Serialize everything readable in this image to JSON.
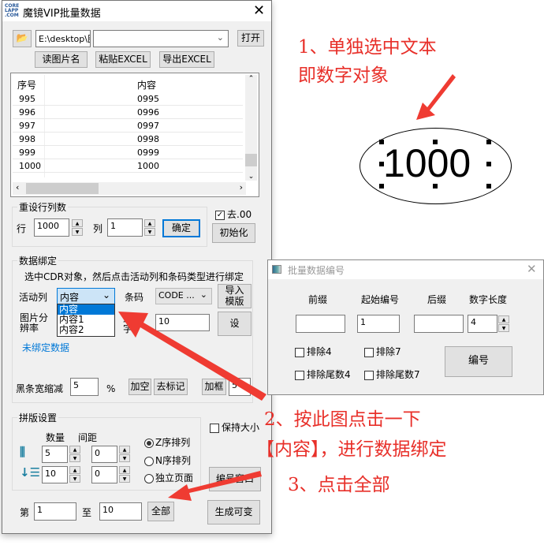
{
  "main": {
    "title": "魔镜VIP批量数据",
    "logo": "CORE LAPP .COM",
    "path": "E:\\desktop\\图",
    "combo": "",
    "open": "打开",
    "read_names": "读图片名",
    "paste_excel": "粘贴EXCEL",
    "export_excel": "导出EXCEL",
    "table": {
      "headers": [
        "序号",
        "内容"
      ],
      "rows": [
        [
          "995",
          "0995"
        ],
        [
          "996",
          "0996"
        ],
        [
          "997",
          "0997"
        ],
        [
          "998",
          "0998"
        ],
        [
          "999",
          "0999"
        ],
        [
          "1000",
          "1000"
        ]
      ]
    },
    "reset": {
      "legend": "重设行列数",
      "row_label": "行",
      "row_value": "1000",
      "col_label": "列",
      "col_value": "1",
      "confirm": "确定",
      "remove00": "去.00",
      "remove00_checked": true,
      "init": "初始化"
    },
    "bind": {
      "legend": "数据绑定",
      "hint": "选中CDR对象，然后点击活动列和条码类型进行绑定",
      "active_label": "活动列",
      "active_value": "内容",
      "options": [
        "内容",
        "内容1",
        "内容2"
      ],
      "barcode_label": "条码",
      "barcode_value": "CODE ...",
      "import_template": "导入模版",
      "img_res": "图片分辨率",
      "max_label": "最大字",
      "max_value": "10",
      "set": "设",
      "unbound": "未绑定数据",
      "bar_reduce_label": "黑条宽缩减",
      "bar_reduce_value": "5",
      "percent": "%",
      "add_blank": "加空",
      "remove_mark": "去标记",
      "add_frame": "加框",
      "frame_value": "5"
    },
    "layout": {
      "legend": "拼版设置",
      "qty": "数量",
      "gap": "间距",
      "h_qty": "5",
      "h_gap": "0",
      "v_qty": "10",
      "v_gap": "0",
      "z_order": "Z序排列",
      "n_order": "N序排列",
      "single": "独立页面",
      "keep_size": "保持大小",
      "number_window": "编号窗口"
    },
    "footer": {
      "from_label": "第",
      "from_value": "1",
      "to_label": "至",
      "to_value": "10",
      "all": "全部",
      "generate": "生成可变"
    }
  },
  "dialog": {
    "title": "批量数据编号",
    "prefix": "前缀",
    "start": "起始编号",
    "suffix": "后缀",
    "length": "数字长度",
    "prefix_value": "",
    "start_value": "1",
    "suffix_value": "",
    "length_value": "4",
    "ex4": "排除4",
    "ex7": "排除7",
    "ex_tail4": "排除尾数4",
    "ex_tail7": "排除尾数7",
    "number": "编号"
  },
  "annotations": {
    "a1_line1": "1、单独选中文本",
    "a1_line2": "即数字对象",
    "sample": "1000",
    "a2_line1": "2、按此图点击一下",
    "a2_line2": "【内容】，进行数据绑定",
    "a3": "3、点击全部",
    "color": "#e8302a"
  }
}
